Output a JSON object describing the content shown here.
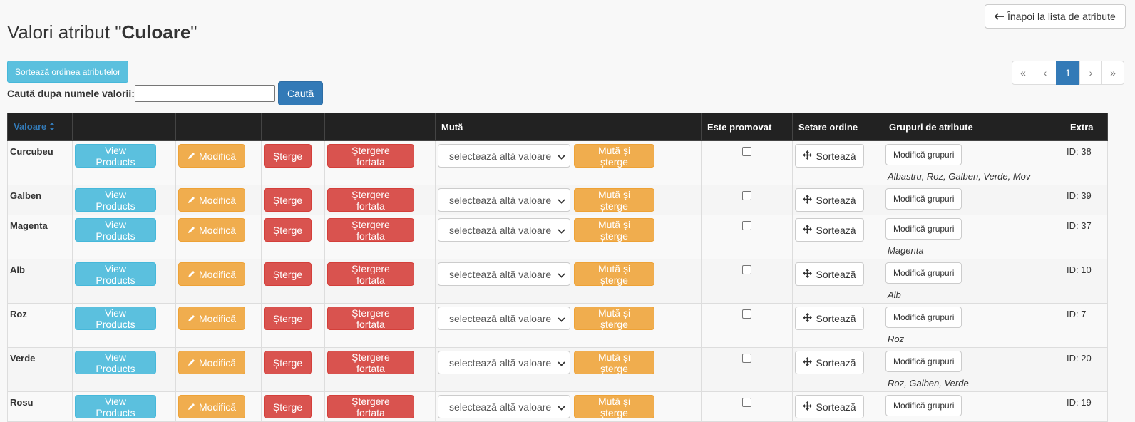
{
  "header": {
    "back_label": "Înapoi la lista de atribute",
    "title_prefix": "Valori atribut \"",
    "title_name": "Culoare",
    "title_suffix": "\""
  },
  "toolbar": {
    "sort_attributes_label": "Sortează ordinea atributelor",
    "search_label": "Caută dupa numele valorii:",
    "search_value": "",
    "search_button": "Caută"
  },
  "pagination": {
    "first": "«",
    "prev": "‹",
    "current": "1",
    "next": "›",
    "last": "»"
  },
  "table": {
    "headers": {
      "value": "Valoare",
      "move": "Mută",
      "promoted": "Este promovat",
      "order": "Setare ordine",
      "groups": "Grupuri de atribute",
      "extra": "Extra"
    },
    "labels": {
      "view_products": "View Products",
      "modify": "Modifică",
      "delete": "Șterge",
      "force_delete": "Ștergere fortata",
      "select_placeholder": "selectează altă valoare",
      "move_delete": "Mută și șterge",
      "sort": "Sortează",
      "modify_groups": "Modifică grupuri"
    },
    "rows": [
      {
        "name": "Curcubeu",
        "groups": "Albastru, Roz, Galben, Verde, Mov",
        "extra": "ID: 38",
        "promoted": false
      },
      {
        "name": "Galben",
        "groups": "",
        "extra": "ID: 39",
        "promoted": false
      },
      {
        "name": "Magenta",
        "groups": "Magenta",
        "extra": "ID: 37",
        "promoted": false
      },
      {
        "name": "Alb",
        "groups": "Alb",
        "extra": "ID: 10",
        "promoted": false
      },
      {
        "name": "Roz",
        "groups": "Roz",
        "extra": "ID: 7",
        "promoted": false
      },
      {
        "name": "Verde",
        "groups": "Roz, Galben, Verde",
        "extra": "ID: 20",
        "promoted": false
      },
      {
        "name": "Rosu",
        "groups": "",
        "extra": "ID: 19",
        "promoted": false
      }
    ]
  },
  "colors": {
    "info": "#5bc0de",
    "warning": "#f0ad4e",
    "danger": "#d9534f",
    "primary": "#337ab7",
    "header_bg": "#222222"
  }
}
